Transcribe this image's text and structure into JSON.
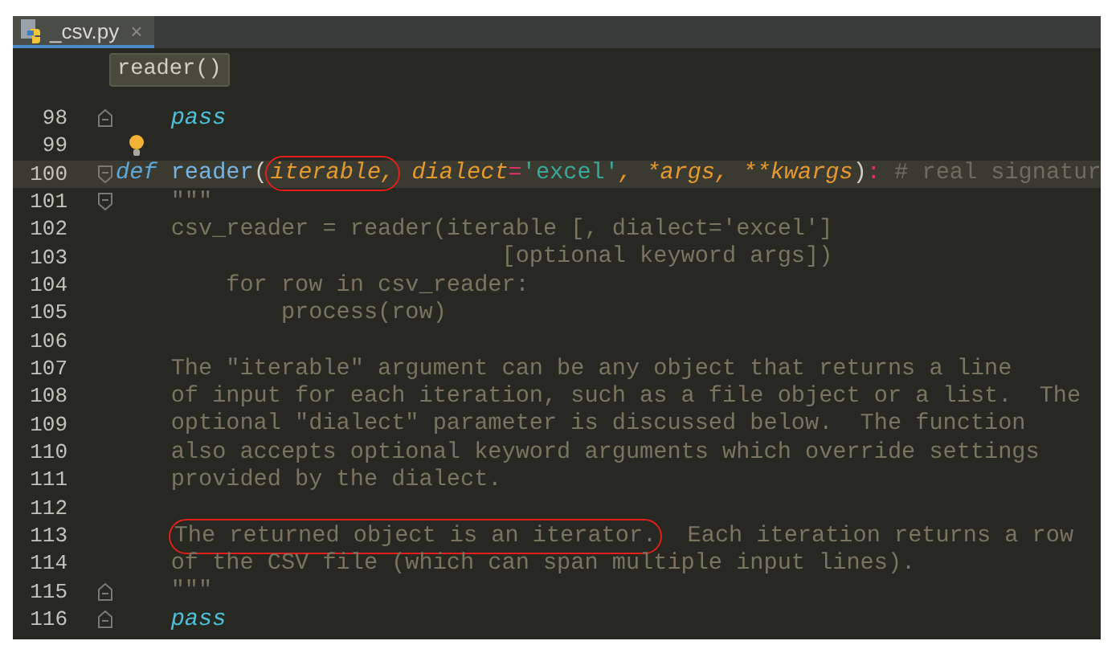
{
  "tab": {
    "label": "_csv.py",
    "close": "×",
    "selected": true
  },
  "breadcrumb": "reader()",
  "lines": [
    {
      "number": "98",
      "fold_end": true,
      "segments": [
        {
          "text": "    pass",
          "kind": "pass"
        }
      ]
    },
    {
      "number": "99",
      "bulb": true
    },
    {
      "number": "100",
      "fold_start": true,
      "current": true,
      "segments": [
        {
          "text": "def",
          "kind": "keyword"
        },
        {
          "text": " reader",
          "kind": "function"
        },
        {
          "text": "(",
          "kind": "plain"
        },
        {
          "text": "iterable,",
          "kind": "param",
          "circled": true
        },
        {
          "text": " dialect",
          "kind": "param"
        },
        {
          "text": "=",
          "kind": "operator"
        },
        {
          "text": "'excel'",
          "kind": "string"
        },
        {
          "text": ", *args, **kwargs",
          "kind": "param"
        },
        {
          "text": ")",
          "kind": "plain"
        },
        {
          "text": ":",
          "kind": "operator"
        },
        {
          "text": " # real signatur",
          "kind": "comment"
        }
      ]
    },
    {
      "number": "101",
      "fold_start": true,
      "segments": [
        {
          "text": "    \"\"\"",
          "kind": "doc"
        }
      ]
    },
    {
      "number": "102",
      "segments": [
        {
          "text": "    csv_reader = reader(iterable [, dialect='excel']",
          "kind": "doc"
        }
      ]
    },
    {
      "number": "103",
      "segments": [
        {
          "text": "                            [optional keyword args])",
          "kind": "doc"
        }
      ]
    },
    {
      "number": "104",
      "segments": [
        {
          "text": "        for row in csv_reader:",
          "kind": "doc"
        }
      ]
    },
    {
      "number": "105",
      "segments": [
        {
          "text": "            process(row)",
          "kind": "doc"
        }
      ]
    },
    {
      "number": "106"
    },
    {
      "number": "107",
      "segments": [
        {
          "text": "    The \"iterable\" argument can be any object that returns a line",
          "kind": "doc"
        }
      ]
    },
    {
      "number": "108",
      "segments": [
        {
          "text": "    of input for each iteration, such as a file object or a list.  The",
          "kind": "doc"
        }
      ]
    },
    {
      "number": "109",
      "segments": [
        {
          "text": "    optional \"dialect\" parameter is discussed below.  The function",
          "kind": "doc"
        }
      ]
    },
    {
      "number": "110",
      "segments": [
        {
          "text": "    also accepts optional keyword arguments which override settings",
          "kind": "doc"
        }
      ]
    },
    {
      "number": "111",
      "segments": [
        {
          "text": "    provided by the dialect.",
          "kind": "doc"
        }
      ]
    },
    {
      "number": "112"
    },
    {
      "number": "113",
      "segments": [
        {
          "text": "    The returned object is an iterator.",
          "kind": "doc",
          "circled": true
        },
        {
          "text": "  Each iteration returns a row",
          "kind": "doc"
        }
      ]
    },
    {
      "number": "114",
      "segments": [
        {
          "text": "    of the CSV file (which can span multiple input lines).",
          "kind": "doc"
        }
      ]
    },
    {
      "number": "115",
      "fold_end": true,
      "segments": [
        {
          "text": "    \"\"\"",
          "kind": "doc"
        }
      ]
    },
    {
      "number": "116",
      "fold_end": true,
      "segments": [
        {
          "text": "    pass",
          "kind": "pass"
        }
      ]
    }
  ]
}
